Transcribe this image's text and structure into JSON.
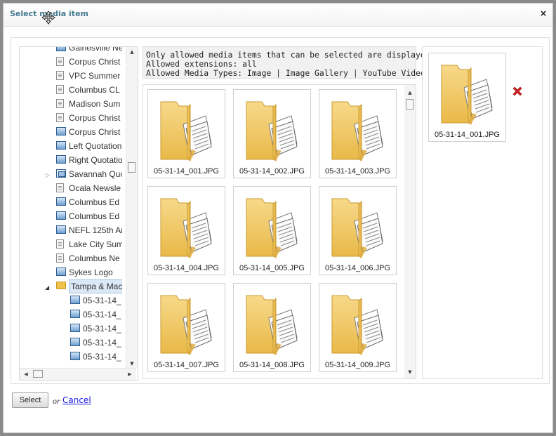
{
  "dialog": {
    "title": "Select media item",
    "close_label": "×"
  },
  "tree": {
    "items": [
      {
        "label": "Gainesville Ne",
        "icon": "image-icon"
      },
      {
        "label": "Corpus Christ",
        "icon": "document-icon"
      },
      {
        "label": "VPC Summer",
        "icon": "document-icon"
      },
      {
        "label": "Columbus CL",
        "icon": "document-icon"
      },
      {
        "label": "Madison Sum",
        "icon": "document-icon"
      },
      {
        "label": "Corpus Christ",
        "icon": "document-icon"
      },
      {
        "label": "Corpus Christ",
        "icon": "image-icon"
      },
      {
        "label": "Left Quotation",
        "icon": "image-icon"
      },
      {
        "label": "Right Quotatio",
        "icon": "image-icon"
      },
      {
        "label": "Savannah Quo",
        "icon": "gallery-icon"
      },
      {
        "label": "Ocala Newsle",
        "icon": "document-icon"
      },
      {
        "label": "Columbus Ed",
        "icon": "image-icon"
      },
      {
        "label": "Columbus Ed",
        "icon": "image-icon"
      },
      {
        "label": "NEFL 125th Ar",
        "icon": "image-icon"
      },
      {
        "label": "Lake City Sum",
        "icon": "document-icon"
      },
      {
        "label": "Columbus Ne",
        "icon": "document-icon"
      },
      {
        "label": "Sykes Logo",
        "icon": "image-icon"
      },
      {
        "label": "Tampa & Mac",
        "icon": "folder-icon"
      },
      {
        "label": "05-31-14_",
        "icon": "image-icon"
      },
      {
        "label": "05-31-14_",
        "icon": "image-icon"
      },
      {
        "label": "05-31-14_",
        "icon": "image-icon"
      },
      {
        "label": "05-31-14_",
        "icon": "image-icon"
      },
      {
        "label": "05-31-14_",
        "icon": "image-icon"
      }
    ]
  },
  "info": {
    "line1": "Only allowed media items that can be selected are displayed.",
    "line2": "Allowed extensions: all",
    "types_label": "Allowed Media Types:",
    "types": [
      "Image",
      "Image Gallery",
      "YouTube Video"
    ],
    "separator": "|"
  },
  "media": {
    "items": [
      "05-31-14_001.JPG",
      "05-31-14_002.JPG",
      "05-31-14_003.JPG",
      "05-31-14_004.JPG",
      "05-31-14_005.JPG",
      "05-31-14_006.JPG",
      "05-31-14_007.JPG",
      "05-31-14_008.JPG",
      "05-31-14_009.JPG"
    ]
  },
  "selected": {
    "items": [
      "05-31-14_001.JPG"
    ]
  },
  "footer": {
    "select_label": "Select",
    "or_label": "or",
    "cancel_label": "Cancel"
  },
  "colors": {
    "title": "#41788f",
    "link": "#1a1ae0",
    "folder": "#f0c24a",
    "remove": "#d42020"
  }
}
